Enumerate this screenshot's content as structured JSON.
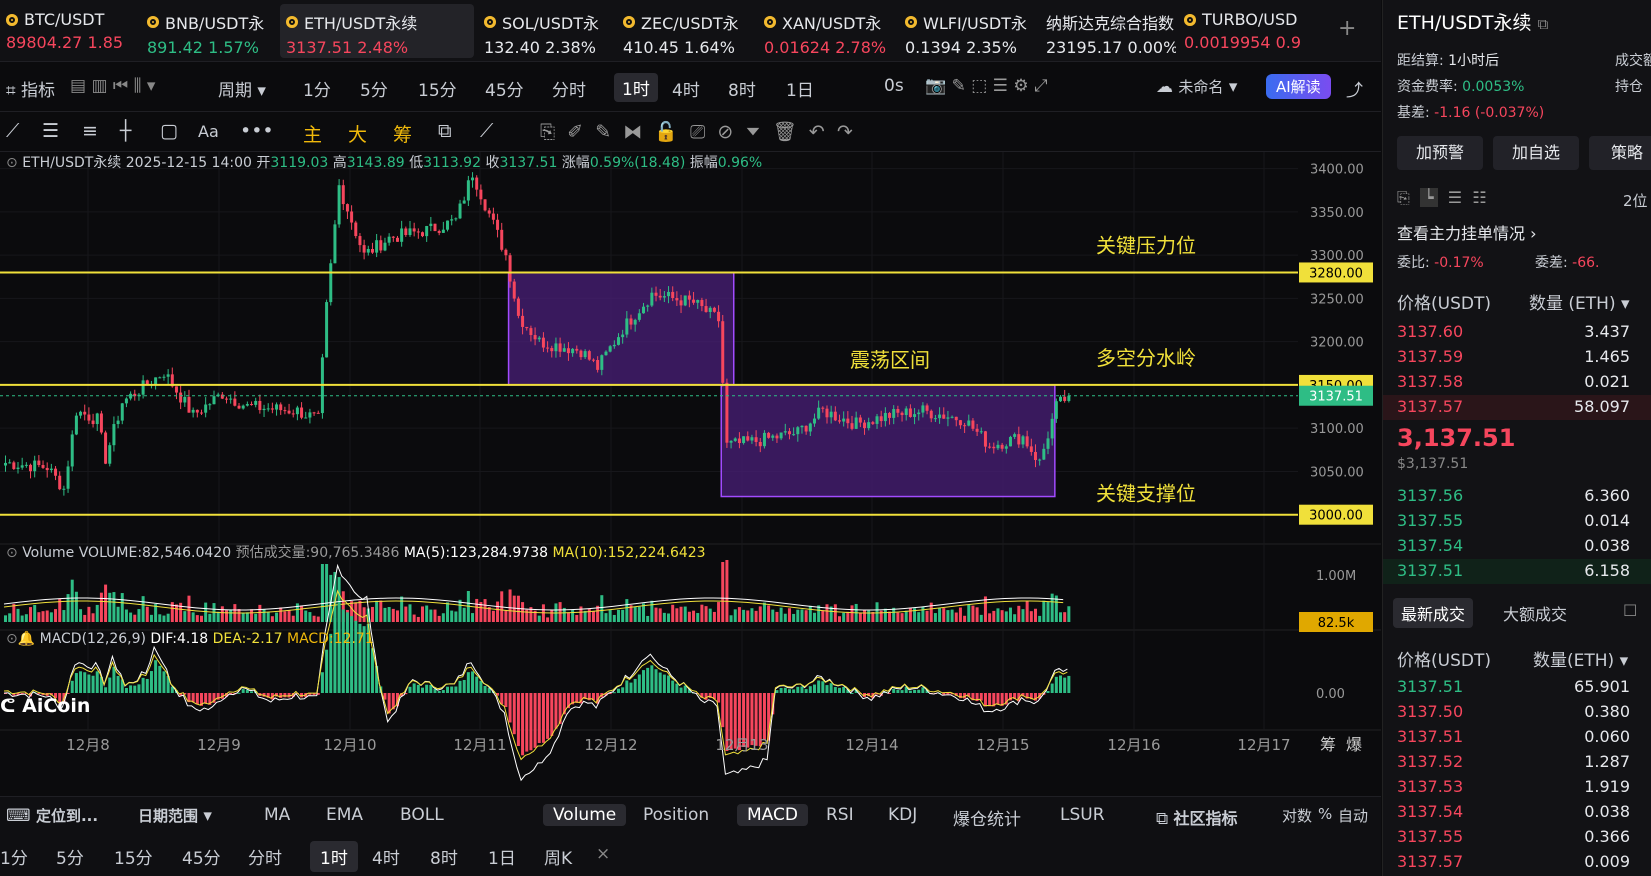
{
  "tickers": [
    {
      "name": "BTC/USDT",
      "price": "89804.27",
      "change": "1.85",
      "dir": "dn",
      "left": 0
    },
    {
      "name": "BNB/USDT永",
      "price": "891.42",
      "change": "1.57%",
      "dir": "up",
      "left": 141
    },
    {
      "name": "ETH/USDT永续",
      "price": "3137.51",
      "change": "2.48%",
      "dir": "dn",
      "left": 280,
      "active": true
    },
    {
      "name": "SOL/USDT永",
      "price": "132.40",
      "change": "2.38%",
      "dir": "wh",
      "left": 478
    },
    {
      "name": "ZEC/USDT永",
      "price": "410.45",
      "change": "1.64%",
      "dir": "wh",
      "left": 617
    },
    {
      "name": "XAN/USDT永",
      "price": "0.01624",
      "change": "2.78%",
      "dir": "dn",
      "left": 758
    },
    {
      "name": "WLFI/USDT永",
      "price": "0.1394",
      "change": "2.35%",
      "dir": "wh",
      "left": 899
    },
    {
      "name": "纳斯达克综合指数",
      "price": "23195.17",
      "change": "0.00%",
      "dir": "wh",
      "left": 1040,
      "nocoin": true
    },
    {
      "name": "TURBO/USD",
      "price": "0.0019954",
      "change": "0.9",
      "dir": "dn",
      "left": 1178
    }
  ],
  "toolbar1": {
    "indicator": "指标",
    "period": "周期",
    "intervals": [
      "1分",
      "5分",
      "15分",
      "45分",
      "分时",
      "1时",
      "4时",
      "8时",
      "1日"
    ],
    "selected": "1时",
    "countdown": "0s",
    "unnamed": "未命名",
    "ai": "AI解读"
  },
  "toolbar2": {
    "main": "主",
    "big": "大",
    "chip": "筹"
  },
  "chart_data": {
    "type": "candlestick",
    "title": "ETH/USDT永续",
    "info": {
      "date": "2025-12-15 14:00",
      "open_label": "开",
      "open": "3119.03",
      "high_label": "高",
      "high": "3143.89",
      "low_label": "低",
      "low": "3113.92",
      "close_label": "收",
      "close": "3137.51",
      "chg_label": "涨幅",
      "chg": "0.59%(18.48)",
      "amp_label": "振幅",
      "amp": "0.96%"
    },
    "ylim": [
      2980,
      3410
    ],
    "y_ticks": [
      "3400.00",
      "3350.00",
      "3300.00",
      "3250.00",
      "3200.00",
      "3150.00",
      "3100.00",
      "3050.00"
    ],
    "y_tick_values": [
      3400,
      3350,
      3300,
      3250,
      3200,
      3150,
      3100,
      3050
    ],
    "x_ticks": [
      "12月8",
      "12月9",
      "12月10",
      "12月11",
      "12月12",
      "12月13",
      "12月14",
      "12月15",
      "12月16",
      "12月17"
    ],
    "levels": [
      {
        "price": 3280,
        "label": "3280.00",
        "note": "关键压力位"
      },
      {
        "price": 3150,
        "label": "3150.00",
        "note": "多空分水岭"
      },
      {
        "price": 3000,
        "label": "3000.00",
        "note": "关键支撑位"
      }
    ],
    "current": {
      "price": 3137.51,
      "label": "3137.51"
    },
    "box_label": "震荡区间",
    "boxes": [
      {
        "t0": 121,
        "t1": 175,
        "lo": 3150,
        "hi": 3280
      },
      {
        "t0": 172,
        "t1": 252,
        "lo": 3021,
        "hi": 3150
      }
    ],
    "waypoints": [
      [
        0,
        3060
      ],
      [
        10,
        3055
      ],
      [
        14,
        3030
      ],
      [
        17,
        3120
      ],
      [
        22,
        3110
      ],
      [
        24,
        3065
      ],
      [
        28,
        3130
      ],
      [
        38,
        3165
      ],
      [
        45,
        3115
      ],
      [
        52,
        3140
      ],
      [
        58,
        3125
      ],
      [
        70,
        3120
      ],
      [
        75,
        3110
      ],
      [
        77,
        3240
      ],
      [
        80,
        3380
      ],
      [
        86,
        3300
      ],
      [
        92,
        3320
      ],
      [
        102,
        3330
      ],
      [
        108,
        3340
      ],
      [
        112,
        3395
      ],
      [
        120,
        3300
      ],
      [
        123,
        3230
      ],
      [
        128,
        3200
      ],
      [
        138,
        3190
      ],
      [
        142,
        3170
      ],
      [
        148,
        3215
      ],
      [
        155,
        3255
      ],
      [
        165,
        3245
      ],
      [
        171,
        3225
      ],
      [
        173,
        3080
      ],
      [
        180,
        3085
      ],
      [
        190,
        3095
      ],
      [
        196,
        3120
      ],
      [
        204,
        3105
      ],
      [
        212,
        3115
      ],
      [
        220,
        3120
      ],
      [
        230,
        3110
      ],
      [
        236,
        3080
      ],
      [
        244,
        3090
      ],
      [
        248,
        3060
      ],
      [
        252,
        3125
      ],
      [
        255,
        3137.51
      ]
    ],
    "volume": {
      "label": "Volume",
      "value": "VOLUME:82,546.0420",
      "est": "预估成交量:90,765.3486",
      "ma5": "MA(5):123,284.9738",
      "ma10": "MA(10):152,224.6423",
      "tick": "1.00M",
      "current": "82.5k"
    },
    "macd": {
      "label": "MACD(12,26,9)",
      "dif": "DIF:4.18",
      "dea": "DEA:-2.17",
      "macd": "MACD:12.71",
      "tick": "0.00"
    },
    "logo": "AiCoin",
    "corner": [
      "筹",
      "爆"
    ]
  },
  "bottombar": {
    "locate": "定位到...",
    "range": "日期范围",
    "inds": [
      "MA",
      "EMA",
      "BOLL"
    ],
    "subs": [
      "Volume",
      "Position",
      "MACD",
      "RSI",
      "KDJ",
      "爆仓统计",
      "LSUR"
    ],
    "community": "社区指标",
    "opts": [
      "对数",
      "%",
      "自动"
    ]
  },
  "bottom2": {
    "intervals": [
      "1分",
      "5分",
      "15分",
      "45分",
      "分时",
      "1时",
      "4时",
      "8时",
      "1日",
      "周K"
    ],
    "selected": "1时",
    "close": "×"
  },
  "right": {
    "title": "ETH/USDT永续",
    "settle_label": "距结算:",
    "settle": "1小时后",
    "deal": "成交额",
    "fund_label": "资金费率:",
    "fund": "0.0053%",
    "hold": "持仓",
    "basis_label": "基差:",
    "basis": "-1.16 (-0.037%)",
    "btns": [
      "加预警",
      "加自选",
      "策略"
    ],
    "depth": "2位",
    "orders_link": "查看主力挂单情况",
    "ratio_label": "委比:",
    "ratio": "-0.17%",
    "diff_label": "委差:",
    "diff": "-66.",
    "col_price": "价格(USDT)",
    "col_qty": "数量 (ETH)",
    "asks": [
      [
        "3137.60",
        "3.437"
      ],
      [
        "3137.59",
        "1.465"
      ],
      [
        "3137.58",
        "0.021"
      ],
      [
        "3137.57",
        "58.097"
      ]
    ],
    "last": "3,137.51",
    "last_usd": "$3,137.51",
    "bids": [
      [
        "3137.56",
        "6.360"
      ],
      [
        "3137.55",
        "0.014"
      ],
      [
        "3137.54",
        "0.038"
      ],
      [
        "3137.51",
        "6.158"
      ]
    ],
    "tab_latest": "最新成交",
    "tab_big": "大额成交",
    "col2_price": "价格(USDT)",
    "col2_qty": "数量(ETH)",
    "trades": [
      [
        "3137.51",
        "65.901",
        "up"
      ],
      [
        "3137.50",
        "0.380",
        "dn"
      ],
      [
        "3137.51",
        "0.060",
        "dn"
      ],
      [
        "3137.52",
        "1.287",
        "dn"
      ],
      [
        "3137.53",
        "1.919",
        "dn"
      ],
      [
        "3137.54",
        "0.038",
        "dn"
      ],
      [
        "3137.55",
        "0.366",
        "dn"
      ],
      [
        "3137.57",
        "0.009",
        "dn"
      ]
    ]
  },
  "colors": {
    "up": "#2ebd85",
    "down": "#f6465d",
    "gold": "#f0e03a",
    "box": "#5a2a8a"
  }
}
